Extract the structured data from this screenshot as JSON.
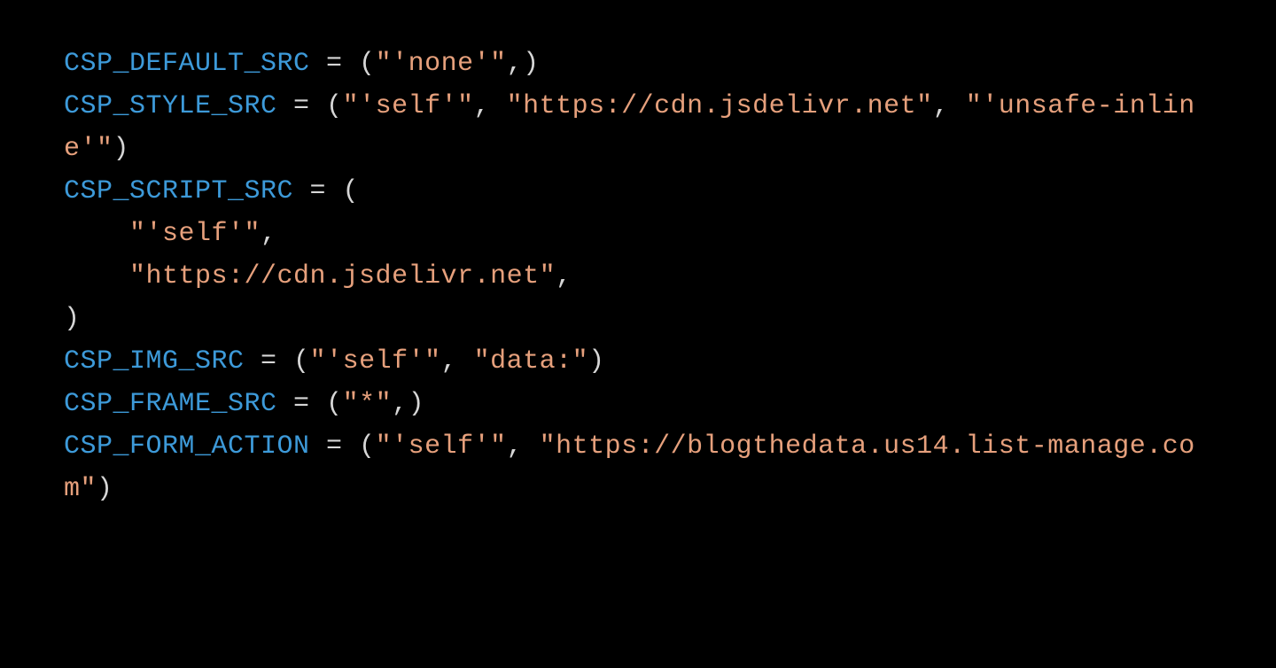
{
  "code": {
    "lines": [
      {
        "indent": 0,
        "segs": [
          {
            "cls": "tok-kw",
            "t": "CSP_DEFAULT_SRC"
          },
          {
            "cls": "tok-op",
            "t": " = ("
          },
          {
            "cls": "tok-str",
            "t": "\"'none'\""
          },
          {
            "cls": "tok-op",
            "t": ",)"
          }
        ]
      },
      {
        "indent": 0,
        "segs": [
          {
            "cls": "tok-kw",
            "t": "CSP_STYLE_SRC"
          },
          {
            "cls": "tok-op",
            "t": " = ("
          },
          {
            "cls": "tok-str",
            "t": "\"'self'\""
          },
          {
            "cls": "tok-op",
            "t": ", "
          },
          {
            "cls": "tok-str",
            "t": "\"https://cdn.jsdelivr.net\""
          },
          {
            "cls": "tok-op",
            "t": ", "
          },
          {
            "cls": "tok-str",
            "t": "\"'unsafe-inline'\""
          },
          {
            "cls": "tok-op",
            "t": ")"
          }
        ]
      },
      {
        "indent": 0,
        "segs": [
          {
            "cls": "tok-kw",
            "t": "CSP_SCRIPT_SRC"
          },
          {
            "cls": "tok-op",
            "t": " = ("
          }
        ]
      },
      {
        "indent": 1,
        "segs": [
          {
            "cls": "tok-str",
            "t": "\"'self'\""
          },
          {
            "cls": "tok-op",
            "t": ","
          }
        ]
      },
      {
        "indent": 1,
        "segs": [
          {
            "cls": "tok-str",
            "t": "\"https://cdn.jsdelivr.net\""
          },
          {
            "cls": "tok-op",
            "t": ","
          }
        ]
      },
      {
        "indent": 0,
        "segs": [
          {
            "cls": "tok-op",
            "t": ")"
          }
        ]
      },
      {
        "indent": 0,
        "segs": [
          {
            "cls": "tok-kw",
            "t": "CSP_IMG_SRC"
          },
          {
            "cls": "tok-op",
            "t": " = ("
          },
          {
            "cls": "tok-str",
            "t": "\"'self'\""
          },
          {
            "cls": "tok-op",
            "t": ", "
          },
          {
            "cls": "tok-str",
            "t": "\"data:\""
          },
          {
            "cls": "tok-op",
            "t": ")"
          }
        ]
      },
      {
        "indent": 0,
        "segs": [
          {
            "cls": "tok-kw",
            "t": "CSP_FRAME_SRC"
          },
          {
            "cls": "tok-op",
            "t": " = ("
          },
          {
            "cls": "tok-str",
            "t": "\"*\""
          },
          {
            "cls": "tok-op",
            "t": ",)"
          }
        ]
      },
      {
        "indent": 0,
        "segs": [
          {
            "cls": "tok-kw",
            "t": "CSP_FORM_ACTION"
          },
          {
            "cls": "tok-op",
            "t": " = ("
          },
          {
            "cls": "tok-str",
            "t": "\"'self'\""
          },
          {
            "cls": "tok-op",
            "t": ", "
          },
          {
            "cls": "tok-str",
            "t": "\"https://blogthedata.us14.list-manage.com\""
          },
          {
            "cls": "tok-op",
            "t": ")"
          }
        ]
      }
    ],
    "indent_unit": "    "
  }
}
